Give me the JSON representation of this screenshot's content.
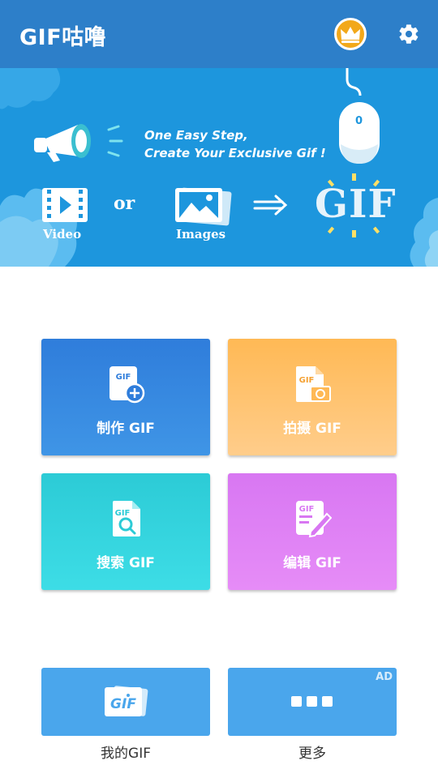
{
  "app": {
    "title": "GIF咕噜"
  },
  "toolbar": {
    "vip_icon": "crown-icon",
    "settings_icon": "gear-icon",
    "accent": "#2d7fc9"
  },
  "banner": {
    "tagline_line1": "One Easy Step,",
    "tagline_line2": "Create Your Exclusive Gif !",
    "video_label": "Video",
    "or_label": "or",
    "images_label": "Images",
    "gif_label": "GIF",
    "mouse_label": "0"
  },
  "tiles": [
    {
      "label": "制作 GIF",
      "icon": "gif-add-icon",
      "color": "#2f7ddb"
    },
    {
      "label": "拍摄 GIF",
      "icon": "gif-camera-icon",
      "color": "#ffb955"
    },
    {
      "label": "搜索 GIF",
      "icon": "gif-search-icon",
      "color": "#2ccbd6"
    },
    {
      "label": "编辑 GIF",
      "icon": "gif-edit-icon",
      "color": "#d877f2"
    }
  ],
  "bottom": {
    "mine": {
      "label": "我的GIF",
      "icon": "gif-stack-icon",
      "icon_text": "GIF"
    },
    "more": {
      "label": "更多",
      "icon": "more-dots-icon",
      "ad_badge": "AD"
    }
  }
}
